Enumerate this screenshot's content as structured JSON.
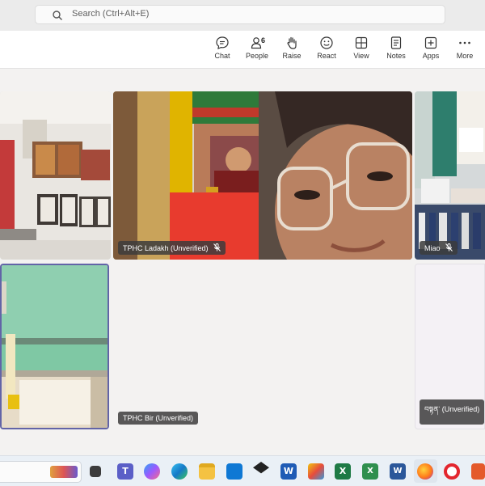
{
  "search": {
    "placeholder": "Search (Ctrl+Alt+E)"
  },
  "toolbar": {
    "items": [
      {
        "label": "Chat"
      },
      {
        "label": "People",
        "count": "6"
      },
      {
        "label": "Raise"
      },
      {
        "label": "React"
      },
      {
        "label": "View"
      },
      {
        "label": "Notes"
      },
      {
        "label": "Apps"
      },
      {
        "label": "More"
      }
    ]
  },
  "participants": [
    {
      "name": "TPHC Ladakh (Unverified)",
      "muted": true
    },
    {
      "name": "Miao",
      "muted": true
    },
    {
      "name": "TPHC Bir (Unverified)",
      "muted": false
    },
    {
      "name": "བསྟན་ (Unverified)",
      "muted": false
    }
  ],
  "taskbar": {
    "icons": [
      "task-view-icon",
      "teams-icon",
      "copilot-icon",
      "edge-icon",
      "file-explorer-icon",
      "outlook-icon",
      "dropbox-icon",
      "word-icon",
      "paint-icon",
      "excel-icon",
      "excel-alt-icon",
      "word-alt-icon",
      "firefox-icon",
      "opera-icon",
      "app-icon"
    ]
  }
}
